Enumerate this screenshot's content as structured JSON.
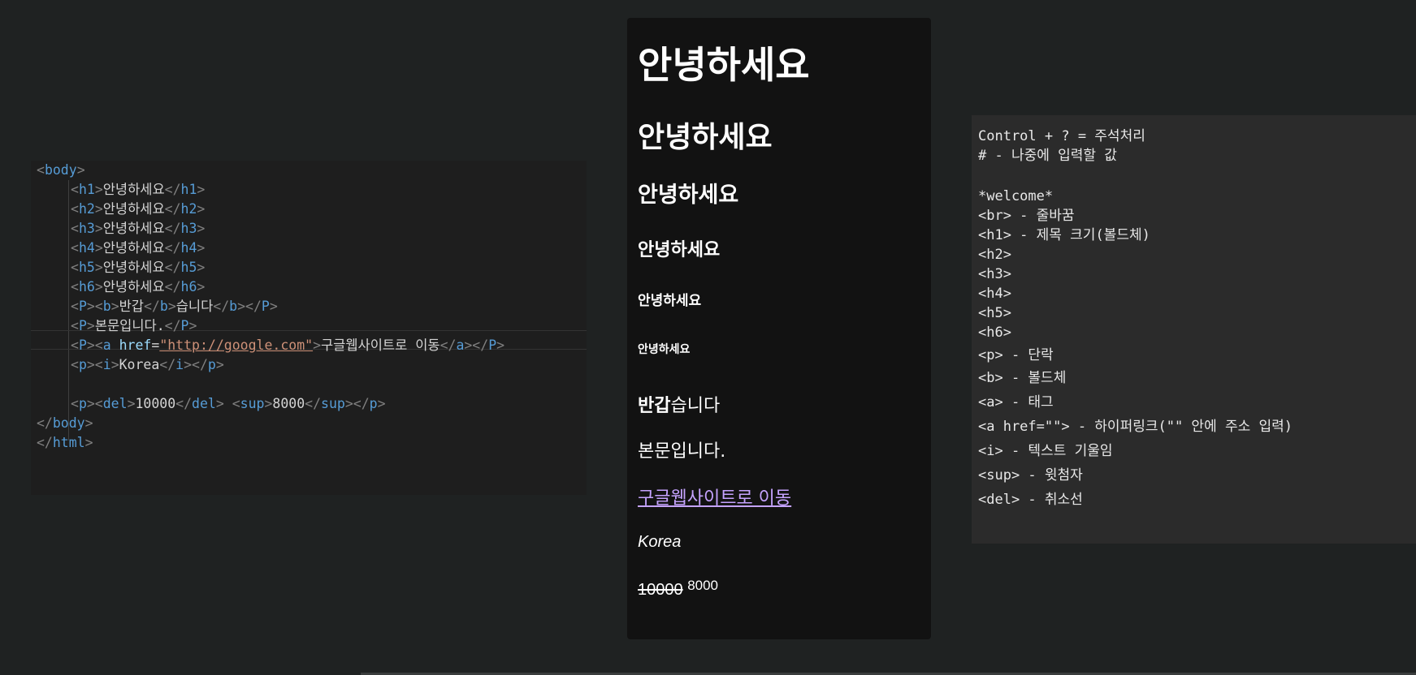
{
  "editor": {
    "lines": {
      "body_open": {
        "tag": "body"
      },
      "h1": {
        "tag": "h1",
        "text": "안녕하세요"
      },
      "h2": {
        "tag": "h2",
        "text": "안녕하세요"
      },
      "h3": {
        "tag": "h3",
        "text": "안녕하세요"
      },
      "h4": {
        "tag": "h4",
        "text": "안녕하세요"
      },
      "h5": {
        "tag": "h5",
        "text": "안녕하세요"
      },
      "h6": {
        "tag": "h6",
        "text": "안녕하세요"
      },
      "p_bold": {
        "p_tag": "P",
        "b_tag": "b",
        "bold_text": "반갑",
        "after_text": "습니다"
      },
      "p_body": {
        "tag": "P",
        "text": "본문입니다."
      },
      "p_link": {
        "p_tag": "P",
        "a_tag": "a",
        "attr": "href",
        "href": "\"http://google.com\"",
        "text": "구글웹사이트로 이동"
      },
      "p_italic": {
        "p_tag": "p",
        "i_tag": "i",
        "text": "Korea"
      },
      "p_del": {
        "p_tag": "p",
        "del_tag": "del",
        "del_text": "10000",
        "sup_tag": "sup",
        "sup_text": "8000"
      },
      "body_close": {
        "tag": "body"
      },
      "html_close": {
        "tag": "html"
      }
    }
  },
  "preview": {
    "h1": "안녕하세요",
    "h2": "안녕하세요",
    "h3": "안녕하세요",
    "h4": "안녕하세요",
    "h5": "안녕하세요",
    "h6": "안녕하세요",
    "bold_text": "반갑",
    "after_bold": "습니다",
    "body_text": "본문입니다.",
    "link_text": "구글웹사이트로 이동",
    "italic_text": "Korea",
    "del_text": "10000",
    "sup_text": "8000",
    "link_color": "#c5a3ff"
  },
  "notes": [
    "Control + ? = 주석처리",
    "# - 나중에 입력할 값",
    "",
    "*welcome*",
    "<br> - 줄바꿈",
    "<h1> - 제목 크기(볼드체)",
    "<h2>",
    "<h3>",
    "<h4>",
    "<h5>",
    "<h6>",
    "<p> - 단락",
    "<b> - 볼드체",
    "<a> - 태그",
    "<a href=\"\"> - 하이퍼링크(\"\" 안에 주소 입력)",
    "<i> - 텍스트 기울임",
    "<sup> - 윗첨자",
    "<del> - 취소선"
  ],
  "colors": {
    "background": "#1f2222",
    "editor_bg": "#1e1e1e",
    "tag_name": "#569cd6",
    "attr_name": "#9cdcfe",
    "attr_value": "#ce9178",
    "bracket": "#808080",
    "preview_bg": "#121212",
    "notes_bg": "#2b2b2b"
  }
}
